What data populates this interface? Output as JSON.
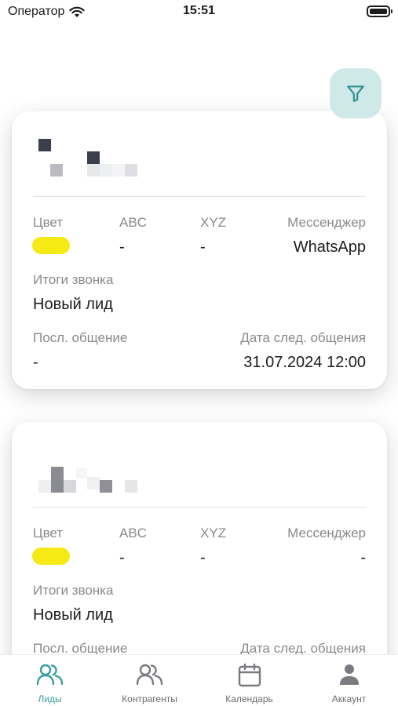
{
  "status_bar": {
    "carrier": "Оператор",
    "time": "15:51"
  },
  "filter_button": {
    "icon": "filter-icon",
    "color": "#cfe8e8"
  },
  "leads": [
    {
      "labels": {
        "color": "Цвет",
        "abc": "ABC",
        "xyz": "XYZ",
        "messenger": "Мессенджер"
      },
      "color_value": "#f5ea14",
      "abc": "-",
      "xyz": "-",
      "messenger": "WhatsApp",
      "call_result_label": "Итоги звонка",
      "call_result": "Новый лид",
      "last_contact_label": "Посл. общение",
      "last_contact": "-",
      "next_contact_label": "Дата след. общения",
      "next_contact": "31.07.2024 12:00"
    },
    {
      "labels": {
        "color": "Цвет",
        "abc": "ABC",
        "xyz": "XYZ",
        "messenger": "Мессенджер"
      },
      "color_value": "#f5ea14",
      "abc": "-",
      "xyz": "-",
      "messenger": "-",
      "call_result_label": "Итоги звонка",
      "call_result": "Новый лид",
      "last_contact_label": "Посл. общение",
      "next_contact_label": "Дата след. общения"
    }
  ],
  "tabbar": {
    "accent": "#3a9e9e",
    "tabs": [
      {
        "label": "Лиды",
        "icon": "users-icon",
        "active": true
      },
      {
        "label": "Контрагенты",
        "icon": "users-icon"
      },
      {
        "label": "Календарь",
        "icon": "calendar-icon"
      },
      {
        "label": "Аккаунт",
        "icon": "person-icon"
      }
    ]
  }
}
